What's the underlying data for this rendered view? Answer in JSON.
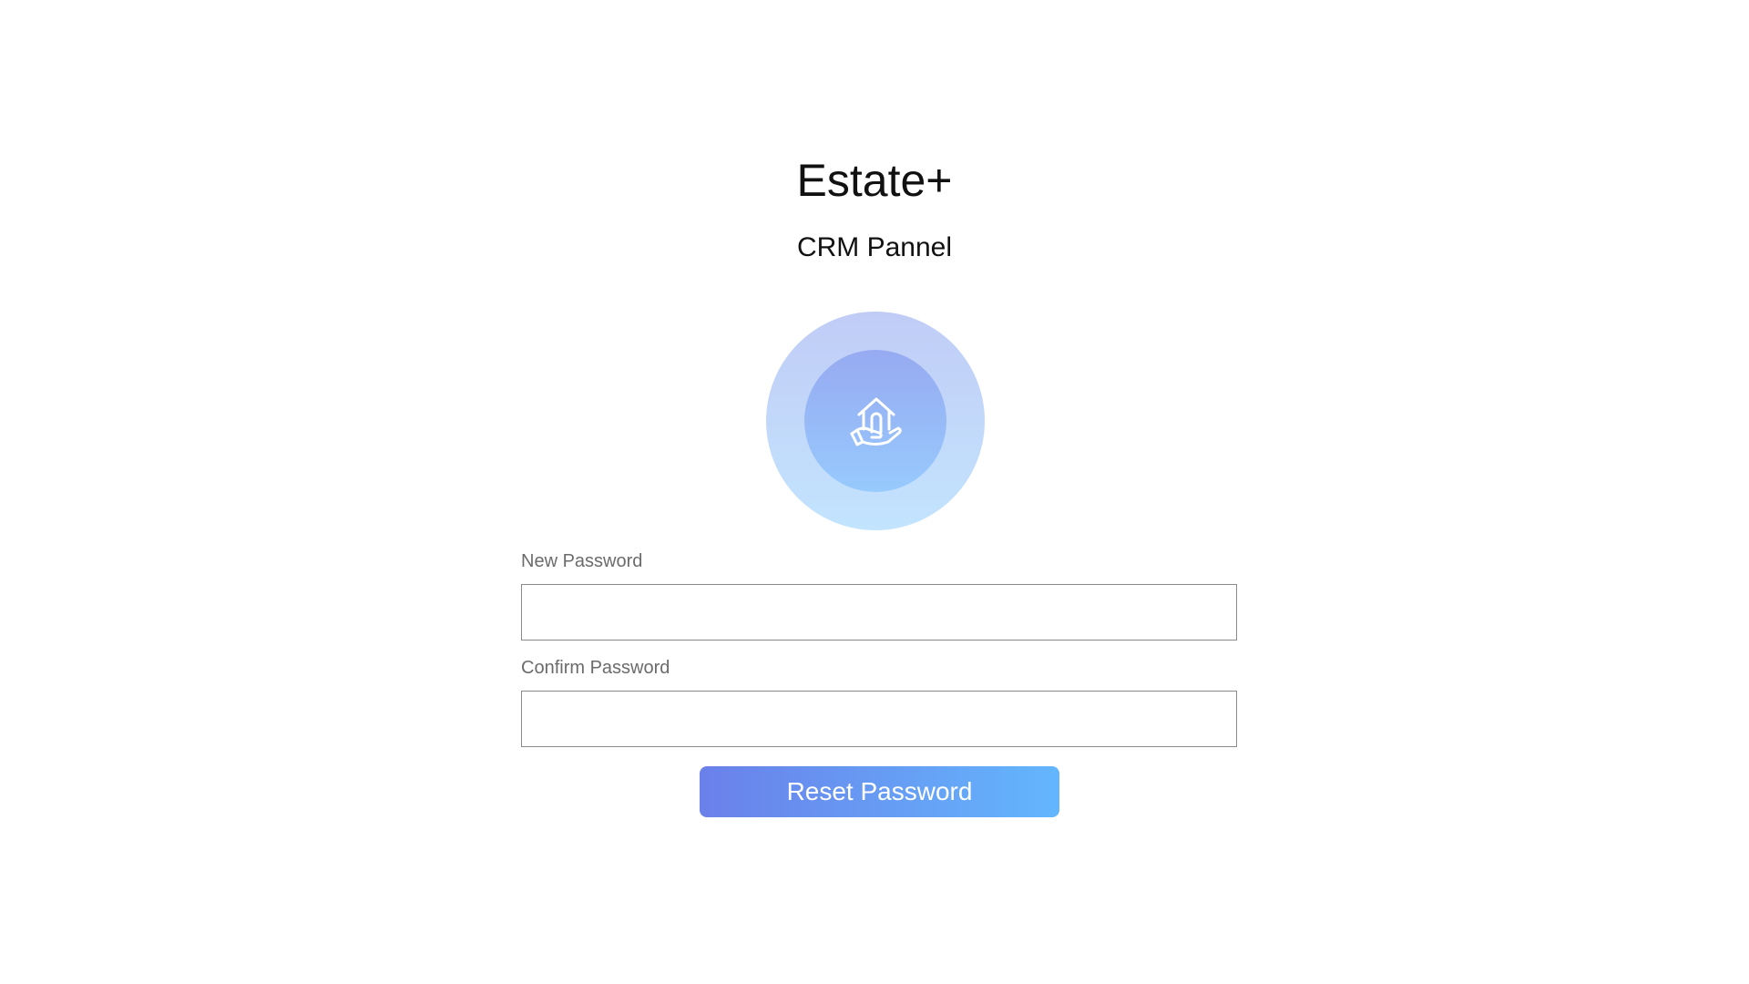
{
  "brand": {
    "title": "Estate+",
    "subtitle": "CRM Pannel",
    "logo_icon": "house-in-hand-icon"
  },
  "form": {
    "new_password": {
      "label": "New Password",
      "value": "",
      "placeholder": ""
    },
    "confirm_password": {
      "label": "Confirm Password",
      "value": "",
      "placeholder": ""
    },
    "submit_label": "Reset Password"
  },
  "colors": {
    "button_gradient_start": "#6a80ea",
    "button_gradient_end": "#63b6fd",
    "logo_outer": "#c1d6fa",
    "logo_inner": "#97b9f7"
  }
}
